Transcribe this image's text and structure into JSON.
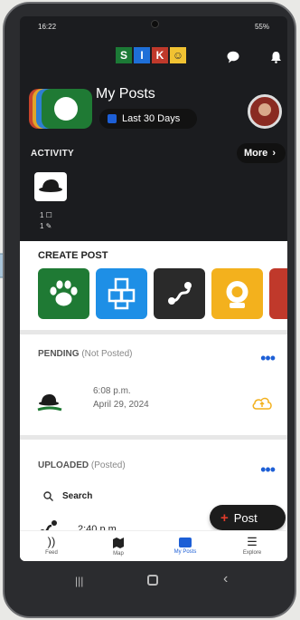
{
  "status": {
    "time": "16:22",
    "battery": "55%"
  },
  "logo": [
    "S",
    "I",
    "K",
    "☺"
  ],
  "header": {
    "title": "My Posts",
    "range": "Last 30 Days"
  },
  "activity": {
    "label": "ACTIVITY",
    "more": "More",
    "stats_line1": "1 ☐",
    "stats_line2": "1 ✎"
  },
  "create_post": {
    "label": "CREATE POST"
  },
  "pending": {
    "title": "PENDING",
    "subtitle": "(Not Posted)",
    "item_time": "6:08 p.m.",
    "item_date": "April 29, 2024"
  },
  "uploaded": {
    "title": "UPLOADED",
    "subtitle": "(Posted)",
    "search": "Search",
    "item_time": "2:40 p.m."
  },
  "post_button": {
    "label": "Post"
  },
  "nav": [
    {
      "label": "Feed"
    },
    {
      "label": "Map"
    },
    {
      "label": "My Posts"
    },
    {
      "label": "Explore"
    }
  ],
  "colors": {
    "accent": "#1d5fd6",
    "paw_tile": "#1f7a34",
    "blocks_tile": "#1e8fe6",
    "route_tile": "#2a2a2a",
    "camera_tile": "#f3b11d",
    "partial_tile": "#c0392b"
  }
}
